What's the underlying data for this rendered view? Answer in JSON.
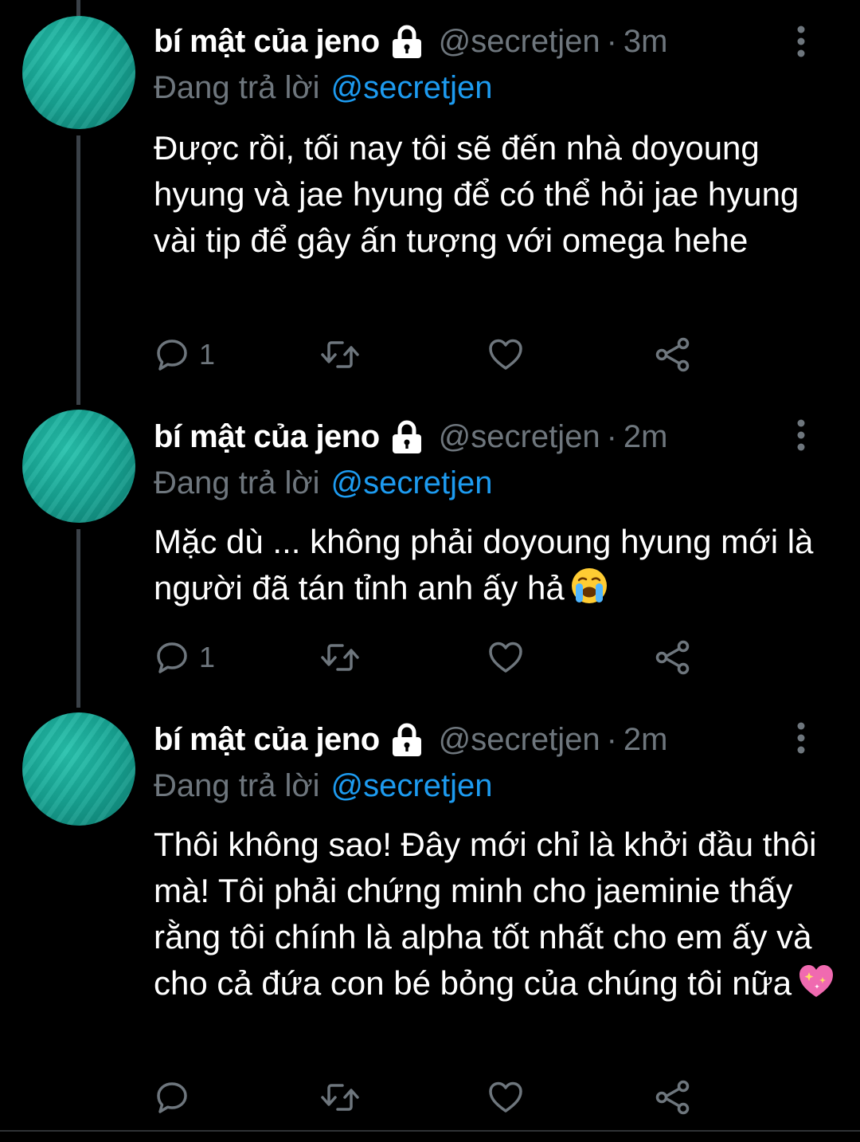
{
  "tweets": [
    {
      "name": "bí mật của jeno",
      "handle": "@secretjen",
      "separator": "·",
      "time": "3m",
      "reply_prefix": "Đang trả lời",
      "reply_handle": "@secretjen",
      "text": "Được rồi, tối nay tôi sẽ đến nhà doyoung hyung và jae hyung để có thể hỏi jae hyung vài tip để gây ấn tượng với omega hehe",
      "emoji": "",
      "reply_count": "1"
    },
    {
      "name": "bí mật của jeno",
      "handle": "@secretjen",
      "separator": "·",
      "time": "2m",
      "reply_prefix": "Đang trả lời",
      "reply_handle": "@secretjen",
      "text": "Mặc dù ... không phải doyoung hyung mới là người đã tán tỉnh anh ấy hả",
      "emoji": "loudly-crying-face",
      "reply_count": "1"
    },
    {
      "name": "bí mật của jeno",
      "handle": "@secretjen",
      "separator": "·",
      "time": "2m",
      "reply_prefix": "Đang trả lời",
      "reply_handle": "@secretjen",
      "text": "Thôi không sao! Đây mới chỉ là khởi đầu thôi mà! Tôi phải chứng minh cho jaeminie thấy rằng tôi chính là alpha tốt nhất cho em ấy và cho cả đứa con bé bỏng của chúng tôi nữa",
      "emoji": "sparkling-heart",
      "reply_count": ""
    }
  ],
  "icons": {
    "lock": "lock-icon",
    "more": "more-vertical-icon",
    "reply": "reply-icon",
    "retweet": "retweet-icon",
    "like": "heart-icon",
    "share": "share-icon"
  },
  "colors": {
    "background": "#000000",
    "secondary_text": "#6e767d",
    "link": "#1d9bf0",
    "thread_line": "#3a4148",
    "avatar": "#17a594"
  }
}
